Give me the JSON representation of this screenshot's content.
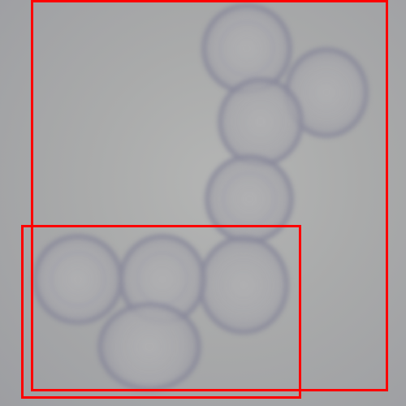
{
  "image": {
    "background_color": "#a9aaaa",
    "cell_outline_color": "#808096",
    "annotation_color": "#ff0000"
  },
  "annotations": [
    {
      "label": ""
    },
    {
      "label": ""
    }
  ]
}
